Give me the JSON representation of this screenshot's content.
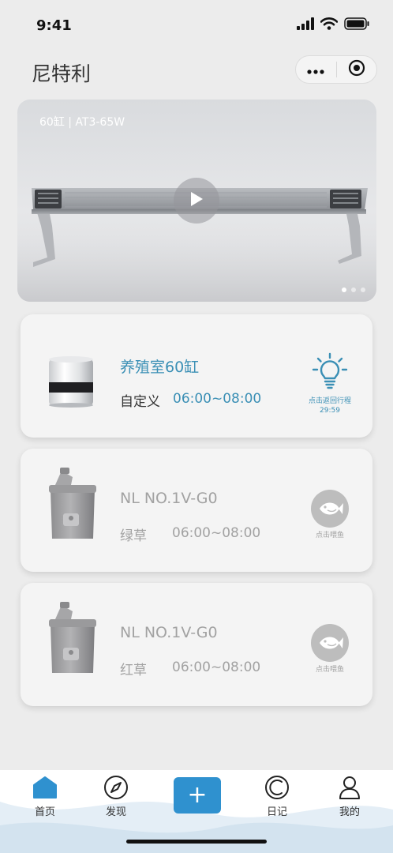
{
  "status_bar": {
    "time": "9:41"
  },
  "header": {
    "title": "尼特利"
  },
  "banner": {
    "caption": "60缸 | AT3-65W",
    "slide_count": 3,
    "active_slide": 1
  },
  "devices": [
    {
      "name": "养殖室60缸",
      "mode": "自定义",
      "time": "06:00~08:00",
      "action_label": "点击返回行程",
      "action_sub": "29:59",
      "action_icon": "bulb-icon",
      "image": "cylinder-light-image"
    },
    {
      "name": "NL NO.1V-G0",
      "mode": "绿草",
      "time": "06:00~08:00",
      "action_label": "点击喂鱼",
      "action_icon": "fish-icon",
      "image": "feeder-image"
    },
    {
      "name": "NL NO.1V-G0",
      "mode": "红草",
      "time": "06:00~08:00",
      "action_label": "点击喂鱼",
      "action_icon": "fish-icon",
      "image": "feeder-image"
    }
  ],
  "tabbar": {
    "items": [
      {
        "label": "首页",
        "icon": "home-icon"
      },
      {
        "label": "发现",
        "icon": "compass-icon"
      },
      {
        "label": "日记",
        "icon": "diary-icon"
      },
      {
        "label": "我的",
        "icon": "profile-icon"
      }
    ],
    "add_label": "+"
  },
  "colors": {
    "accent": "#3a8fb5",
    "add_button": "#2f91cf",
    "inactive_text": "#a2a2a2"
  }
}
